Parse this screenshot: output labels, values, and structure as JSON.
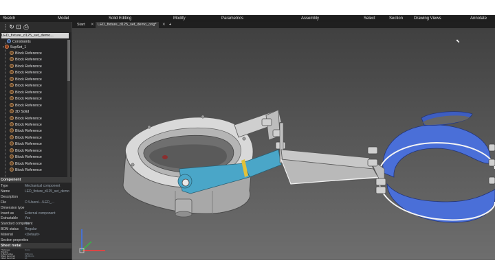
{
  "ribbon": {
    "tabs": [
      "Sketch",
      "Model",
      "Solid Editing",
      "Modify",
      "Parametrics",
      "Assembly",
      "Select",
      "Section",
      "Drawing Views",
      "Annotate"
    ]
  },
  "toolbar": {
    "icons": [
      "hierarchy-icon",
      "refresh-icon",
      "lock-icon",
      "print-icon"
    ]
  },
  "tree": {
    "root": "LED_fixture_d125_set_demo...",
    "constraints": "Constraints",
    "subset": "SupSet_1",
    "items": [
      "Block Reference",
      "Block Reference",
      "Block Reference",
      "Block Reference",
      "Block Reference",
      "Block Reference",
      "Block Reference",
      "Block Reference",
      "Block Reference",
      "3D Solid",
      "Block Reference",
      "Block Reference",
      "Block Reference",
      "Block Reference",
      "Block Reference",
      "Block Reference",
      "Block Reference",
      "Block Reference",
      "Block Reference"
    ]
  },
  "properties": {
    "section_component": "Component",
    "rows": [
      {
        "k": "Type",
        "v": "Mechanical component"
      },
      {
        "k": "Name",
        "v": "LED_fixture_d125_set_demo"
      },
      {
        "k": "Description",
        "v": ""
      },
      {
        "k": "File",
        "v": "C:\\Users\\...\\LED_..."
      },
      {
        "k": "Dimension type",
        "v": ""
      },
      {
        "k": "Insert as",
        "v": "External component"
      },
      {
        "k": "Extractable",
        "v": "Yes"
      },
      {
        "k": "Standard component",
        "v": "No"
      },
      {
        "k": "BOM status",
        "v": "Regular"
      },
      {
        "k": "Material",
        "v": "<Default>"
      },
      {
        "k": "Section properties",
        "v": ""
      }
    ],
    "section_sheet": "Sheet metal",
    "sheet_rows": [
      {
        "k": "Thickness",
        "v": "3 mm"
      },
      {
        "k": "Welding",
        "v": ""
      },
      {
        "k": "K-Bend value",
        "v": "0.50 mm"
      },
      {
        "k": "Sharp bend rad",
        "v": "15.00 mm"
      },
      {
        "k": "Inflect bend rad",
        "v": "10"
      }
    ]
  },
  "doc_tabs": [
    "Start",
    "LED_fixture_d125_set_demo_orig*",
    "+"
  ],
  "colors": {
    "accent_blue": "#4a6fd8",
    "part_cyan": "#4aa6c8",
    "metal": "#cfcfcf"
  }
}
